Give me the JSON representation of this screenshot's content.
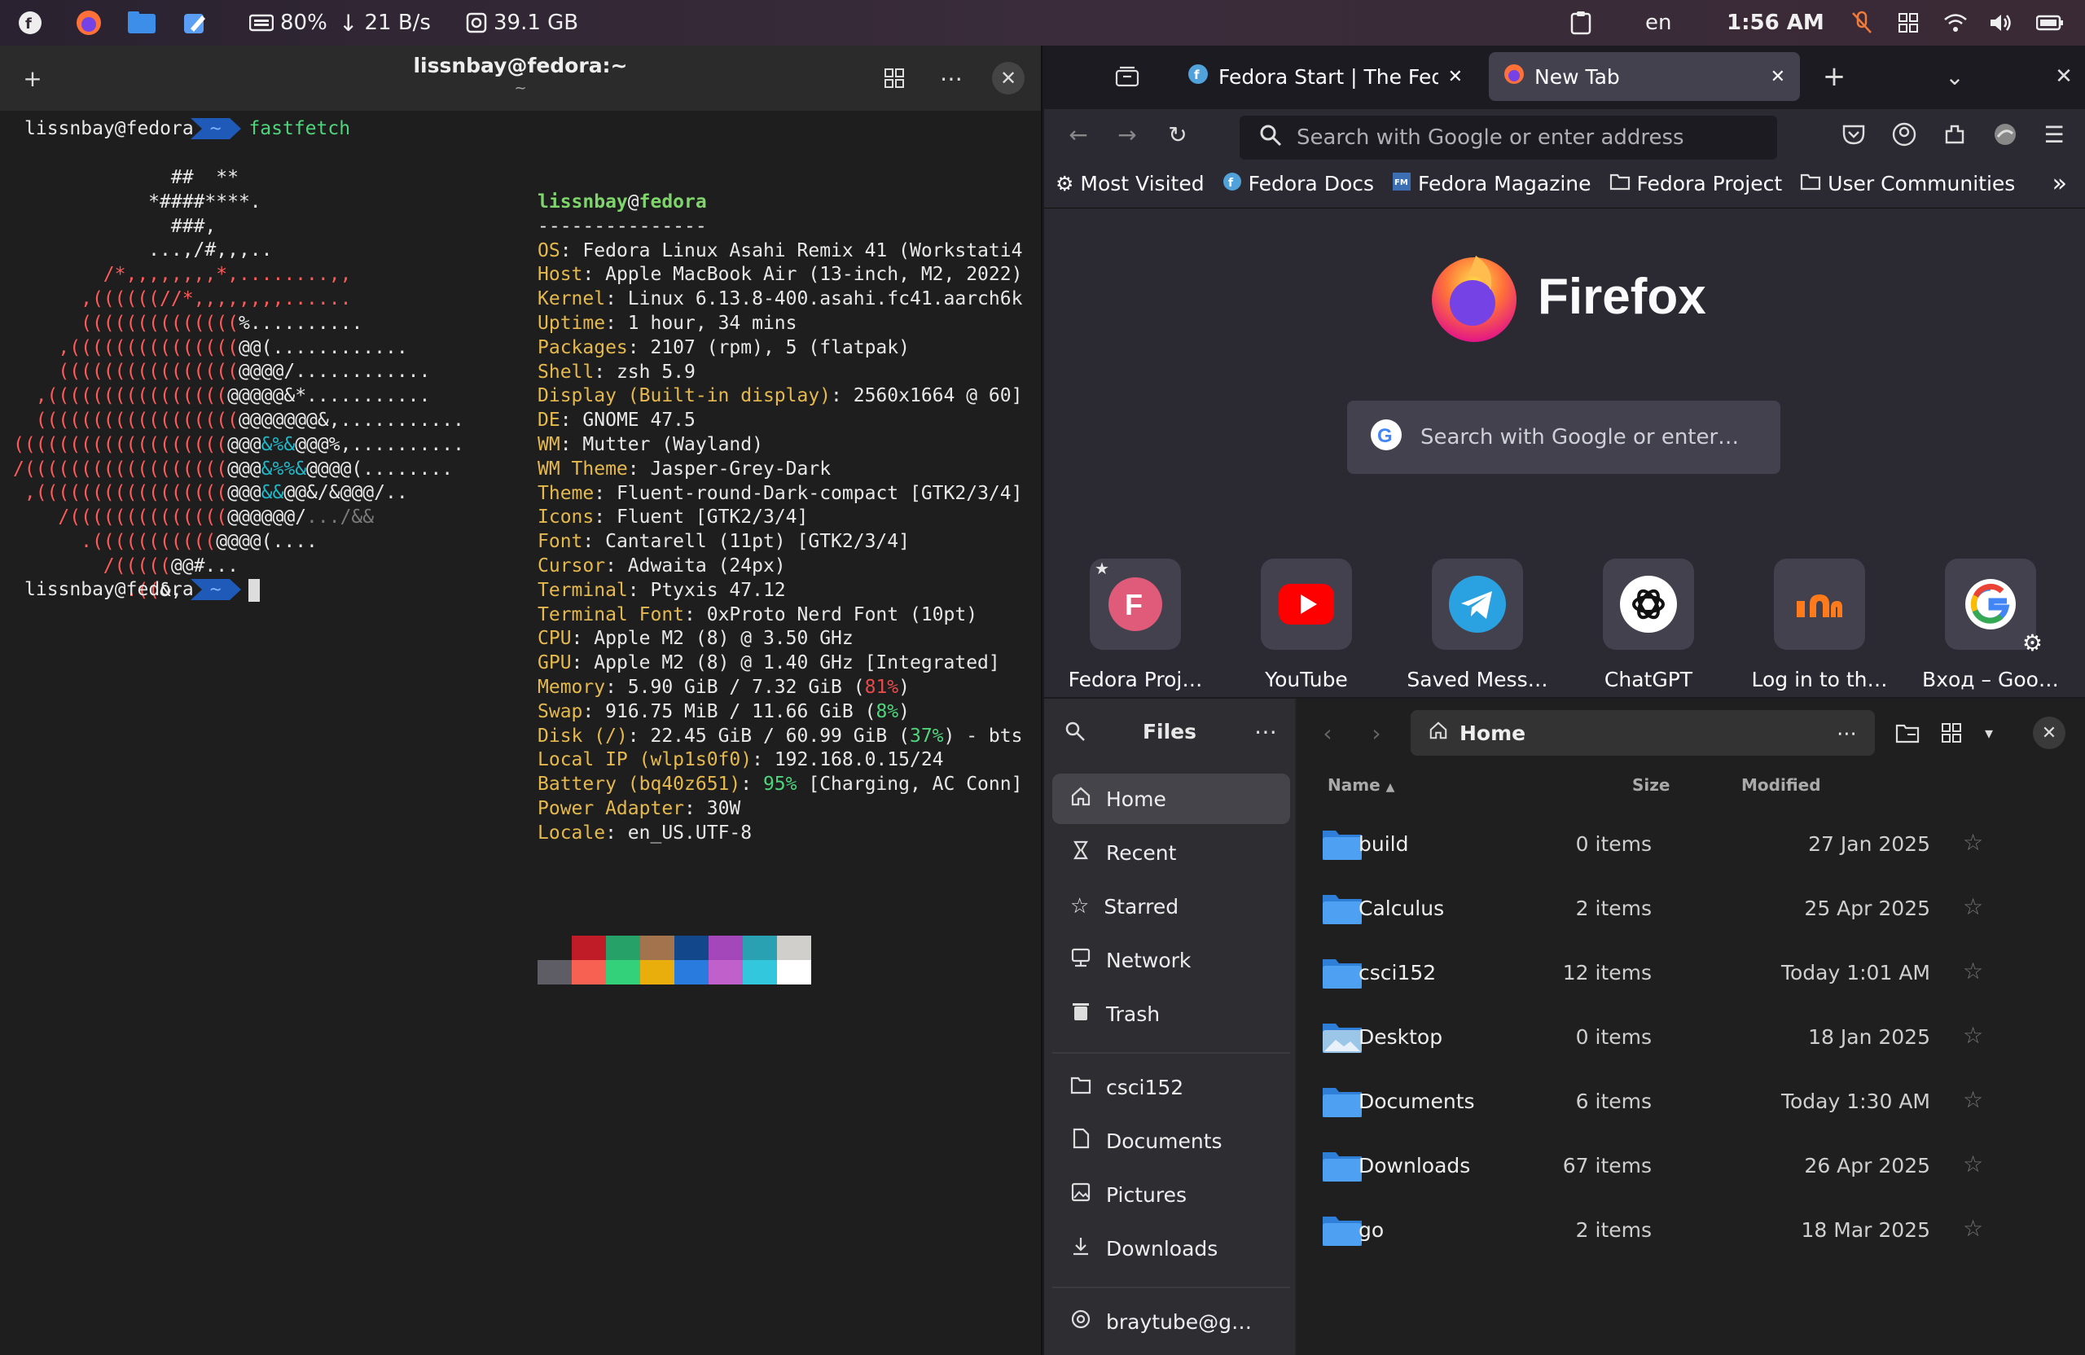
{
  "topbar": {
    "battery_pct": "80%",
    "net_rate": "21 B/s",
    "disk_free": "39.1 GB",
    "lang": "en",
    "clock": "1:56 AM"
  },
  "terminal": {
    "title": "lissnbay@fedora:~",
    "subtitle": "~",
    "prompt_user": "lissnbay@fedora",
    "prompt_dir": "~",
    "command": "fastfetch",
    "header_user": "lissnbay",
    "header_at": "@",
    "header_host": "fedora",
    "separator": "---------------",
    "info": [
      {
        "k": "OS",
        "v": "Fedora Linux Asahi Remix 41 (Workstati4"
      },
      {
        "k": "Host",
        "v": "Apple MacBook Air (13-inch, M2, 2022)"
      },
      {
        "k": "Kernel",
        "v": "Linux 6.13.8-400.asahi.fc41.aarch6k"
      },
      {
        "k": "Uptime",
        "v": "1 hour, 34 mins"
      },
      {
        "k": "Packages",
        "v": "2107 (rpm), 5 (flatpak)"
      },
      {
        "k": "Shell",
        "v": "zsh 5.9"
      },
      {
        "k": "Display (Built-in display)",
        "v": "2560x1664 @ 60]"
      },
      {
        "k": "DE",
        "v": "GNOME 47.5"
      },
      {
        "k": "WM",
        "v": "Mutter (Wayland)"
      },
      {
        "k": "WM Theme",
        "v": "Jasper-Grey-Dark"
      },
      {
        "k": "Theme",
        "v": "Fluent-round-Dark-compact [GTK2/3/4]"
      },
      {
        "k": "Icons",
        "v": "Fluent [GTK2/3/4]"
      },
      {
        "k": "Font",
        "v": "Cantarell (11pt) [GTK2/3/4]"
      },
      {
        "k": "Cursor",
        "v": "Adwaita (24px)"
      },
      {
        "k": "Terminal",
        "v": "Ptyxis 47.12"
      },
      {
        "k": "Terminal Font",
        "v": "0xProto Nerd Font (10pt)"
      },
      {
        "k": "CPU",
        "v": "Apple M2 (8) @ 3.50 GHz"
      },
      {
        "k": "GPU",
        "v": "Apple M2 (8) @ 1.40 GHz [Integrated]"
      },
      {
        "k": "Memory",
        "v": "5.90 GiB / 7.32 GiB (",
        "pct": "81%",
        "tail": ")",
        "pct_color": "red"
      },
      {
        "k": "Swap",
        "v": "916.75 MiB / 11.66 GiB (",
        "pct": "8%",
        "tail": ")",
        "pct_color": "grn"
      },
      {
        "k": "Disk (/)",
        "v": "22.45 GiB / 60.99 GiB (",
        "pct": "37%",
        "tail": ") - bts",
        "pct_color": "grn"
      },
      {
        "k": "Local IP (wlp1s0f0)",
        "v": "192.168.0.15/24"
      },
      {
        "k": "Battery (bq40z651)",
        "v": "",
        "pct": "95%",
        "tail": " [Charging, AC Conn]",
        "pct_color": "grn"
      },
      {
        "k": "Power Adapter",
        "v": "30W"
      },
      {
        "k": "Locale",
        "v": "en_US.UTF-8"
      }
    ],
    "swatch_colors": [
      "#1e1e1e",
      "#c01c28",
      "#26a269",
      "#a2734c",
      "#12488b",
      "#a347ba",
      "#2aa1b3",
      "#d0cfcc",
      "#5e5c64",
      "#f66151",
      "#33d17a",
      "#e9ad0c",
      "#2a7bde",
      "#c061cb",
      "#33c7de",
      "#ffffff"
    ]
  },
  "firefox": {
    "tabs": [
      {
        "label": "Fedora Start | The Fedora"
      },
      {
        "label": "New Tab"
      }
    ],
    "url_placeholder": "Search with Google or enter address",
    "bookmarks": [
      {
        "label": "Most Visited",
        "icon": "gear-icon"
      },
      {
        "label": "Fedora Docs",
        "icon": "fedora-icon"
      },
      {
        "label": "Fedora Magazine",
        "icon": "fm-icon"
      },
      {
        "label": "Fedora Project",
        "icon": "folder-icon"
      },
      {
        "label": "User Communities",
        "icon": "folder-icon"
      }
    ],
    "brand": "Firefox",
    "search_placeholder": "Search with Google or enter…",
    "shortcuts": [
      {
        "label": "Fedora Proj…"
      },
      {
        "label": "YouTube"
      },
      {
        "label": "Saved Mess…"
      },
      {
        "label": "ChatGPT"
      },
      {
        "label": "Log in to th…"
      },
      {
        "label": "Вход – Goo…"
      }
    ]
  },
  "files": {
    "sidebar_title": "Files",
    "places": [
      {
        "label": "Home",
        "icon": "home-icon"
      },
      {
        "label": "Recent",
        "icon": "recent-icon"
      },
      {
        "label": "Starred",
        "icon": "star-icon"
      },
      {
        "label": "Network",
        "icon": "network-icon"
      },
      {
        "label": "Trash",
        "icon": "trash-icon"
      }
    ],
    "bookmarks": [
      {
        "label": "csci152",
        "icon": "folder-icon"
      },
      {
        "label": "Documents",
        "icon": "document-icon"
      },
      {
        "label": "Pictures",
        "icon": "picture-icon"
      },
      {
        "label": "Downloads",
        "icon": "download-icon"
      }
    ],
    "account": "braytube@g…",
    "path": "Home",
    "columns": {
      "name": "Name",
      "size": "Size",
      "modified": "Modified"
    },
    "rows": [
      {
        "name": "build",
        "size": "0 items",
        "modified": "27 Jan 2025"
      },
      {
        "name": "Calculus",
        "size": "2 items",
        "modified": "25 Apr 2025"
      },
      {
        "name": "csci152",
        "size": "12 items",
        "modified": "Today 1:01 AM"
      },
      {
        "name": "Desktop",
        "size": "0 items",
        "modified": "18 Jan 2025"
      },
      {
        "name": "Documents",
        "size": "6 items",
        "modified": "Today 1:30 AM"
      },
      {
        "name": "Downloads",
        "size": "67 items",
        "modified": "26 Apr 2025"
      },
      {
        "name": "go",
        "size": "2 items",
        "modified": "18 Mar 2025"
      }
    ]
  }
}
